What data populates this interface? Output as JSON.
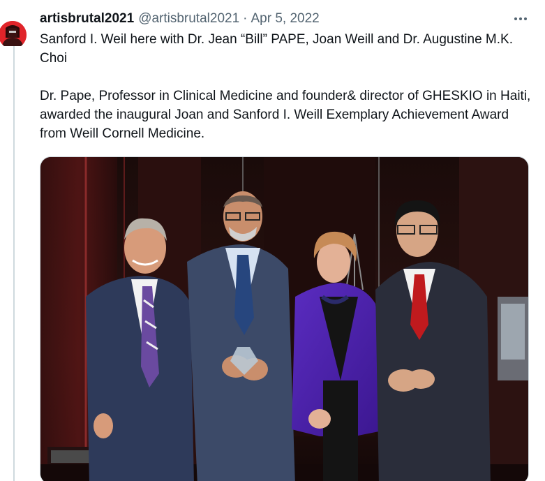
{
  "author": {
    "display_name": "artisbrutal2021",
    "handle": "@artisbrutal2021",
    "separator": "·",
    "date": "Apr 5, 2022"
  },
  "icons": {
    "more": "more-horizontal-icon",
    "avatar": "avatar-image"
  },
  "tweet": {
    "line1": "Sanford I. Weil here with Dr. Jean “Bill” PAPE, Joan Weill and Dr. Augustine M.K. Choi",
    "line2": "Dr. Pape, Professor in Clinical Medicine and founder& director of GHESKIO in Haiti,  awarded the inaugural Joan and Sanford I. Weill Exemplary Achievement Award from Weill Cornell Medicine."
  },
  "media": {
    "kind": "photo"
  },
  "colors": {
    "text": "#0f1419",
    "secondary": "#536471",
    "border": "#cfd9de",
    "avatar_bg": "#e0242a"
  }
}
